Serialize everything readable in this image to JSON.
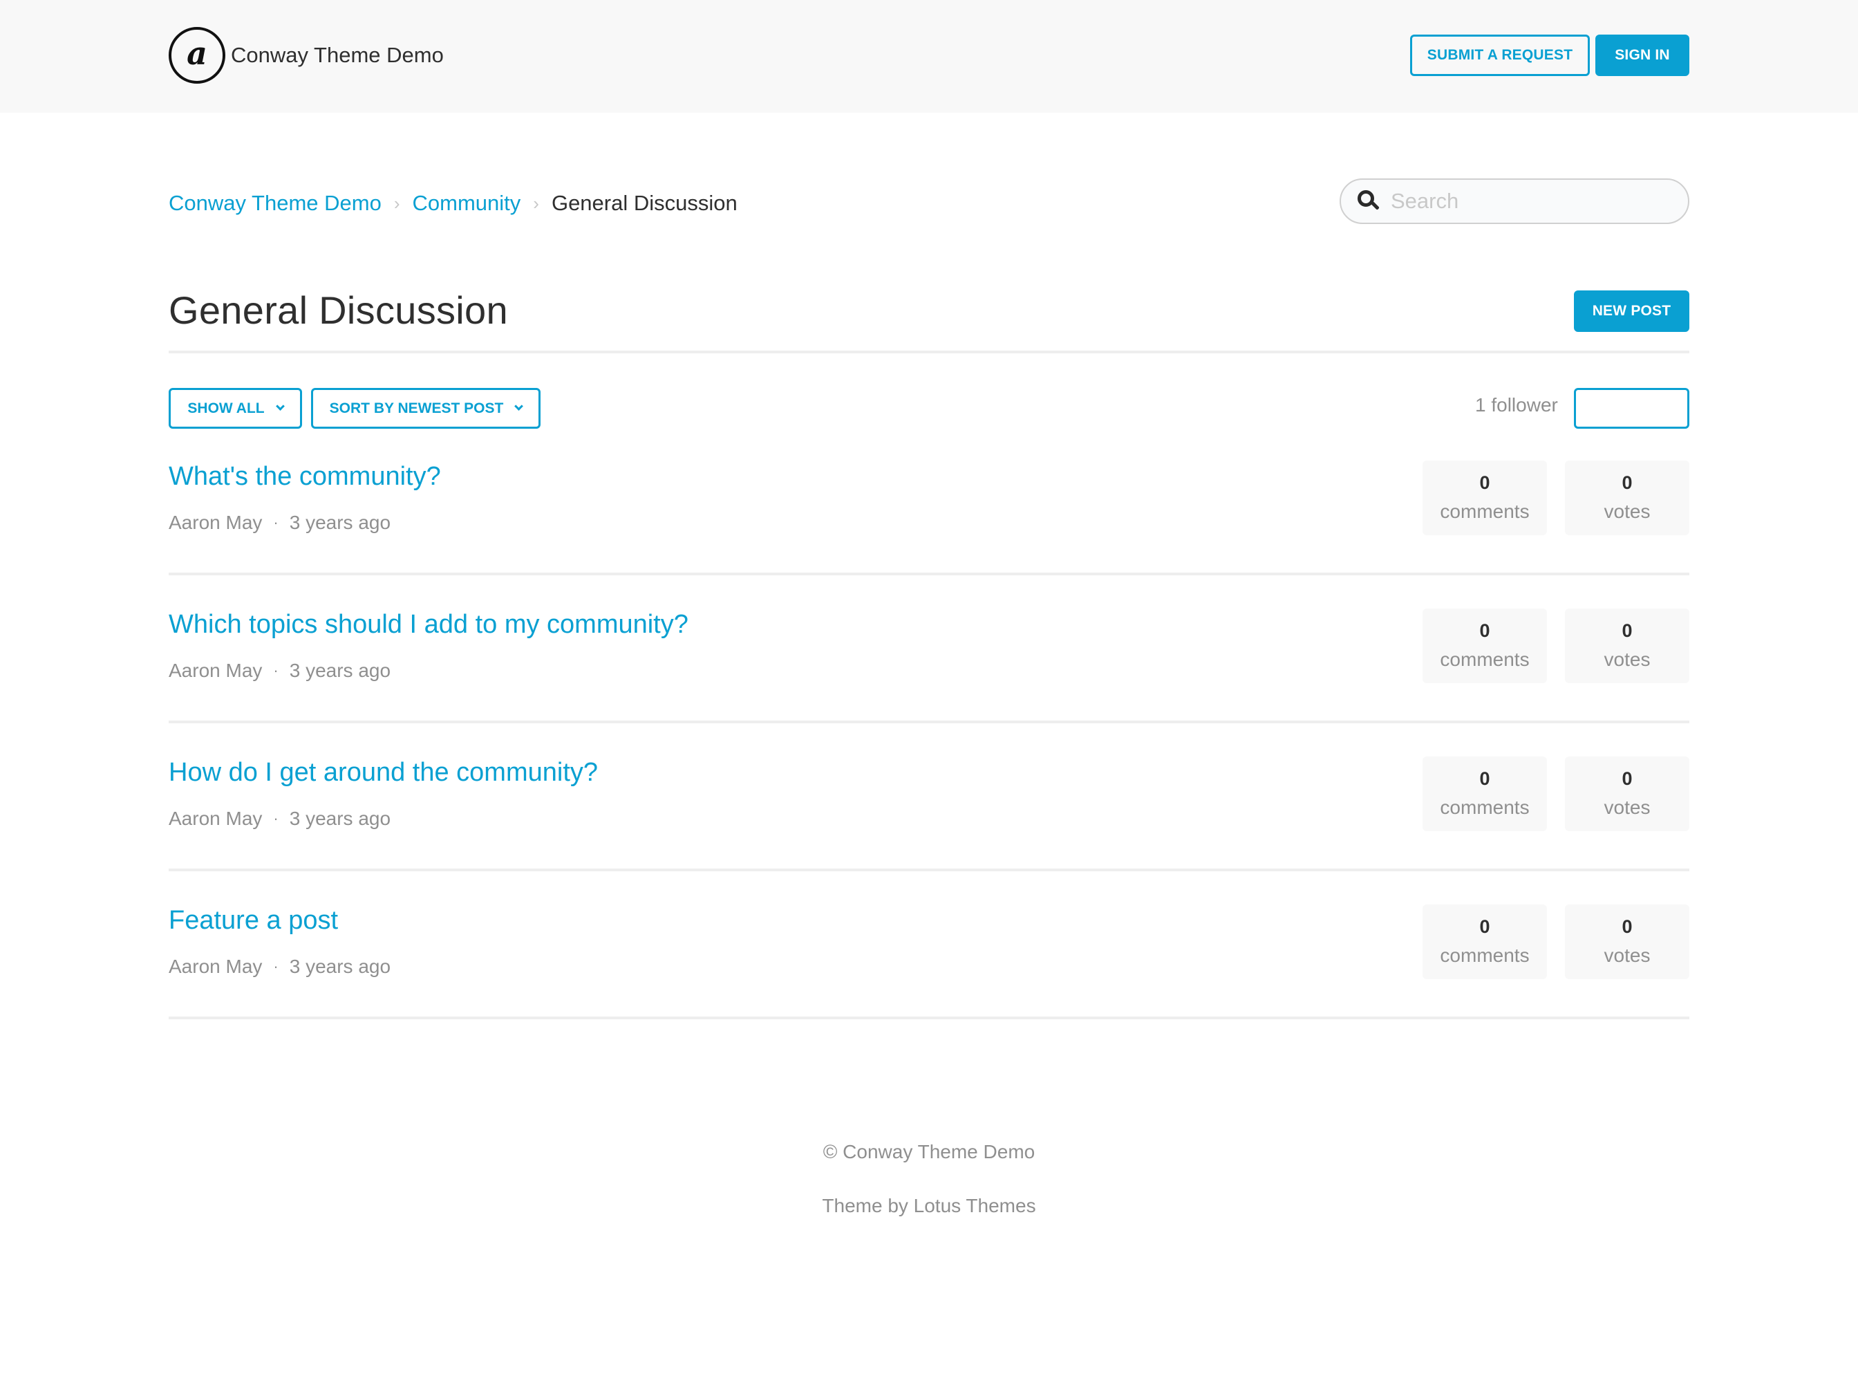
{
  "header": {
    "logo_glyph": "a",
    "brand_name": "Conway Theme Demo",
    "submit_request_label": "SUBMIT A REQUEST",
    "sign_in_label": "SIGN IN"
  },
  "breadcrumb": {
    "items": [
      {
        "label": "Conway Theme Demo",
        "link": true
      },
      {
        "label": "Community",
        "link": true
      },
      {
        "label": "General Discussion",
        "link": false
      }
    ],
    "separator": "›"
  },
  "search": {
    "placeholder": "Search",
    "value": "",
    "icon": "search-icon"
  },
  "topic": {
    "title": "General Discussion",
    "new_post_label": "NEW POST",
    "filter_label": "SHOW ALL",
    "sort_label": "SORT BY NEWEST POST",
    "followers_text": "1 follower",
    "follow_button_label": ""
  },
  "posts": [
    {
      "title": "What's the community?",
      "author": "Aaron May",
      "separator": "·",
      "time": "3 years ago",
      "comments": "0",
      "comments_label": "comments",
      "votes": "0",
      "votes_label": "votes"
    },
    {
      "title": "Which topics should I add to my community?",
      "author": "Aaron May",
      "separator": "·",
      "time": "3 years ago",
      "comments": "0",
      "comments_label": "comments",
      "votes": "0",
      "votes_label": "votes"
    },
    {
      "title": "How do I get around the community?",
      "author": "Aaron May",
      "separator": "·",
      "time": "3 years ago",
      "comments": "0",
      "comments_label": "comments",
      "votes": "0",
      "votes_label": "votes"
    },
    {
      "title": "Feature a post",
      "author": "Aaron May",
      "separator": "·",
      "time": "3 years ago",
      "comments": "0",
      "comments_label": "comments",
      "votes": "0",
      "votes_label": "votes"
    }
  ],
  "footer": {
    "copyright": "© Conway Theme Demo",
    "credit": "Theme by Lotus Themes"
  },
  "colors": {
    "accent": "#0aa0d2",
    "header_bg": "#f8f8f8",
    "text_primary": "#2f2f2f",
    "text_muted": "#8f8f8f",
    "divider": "#eeeeee"
  }
}
